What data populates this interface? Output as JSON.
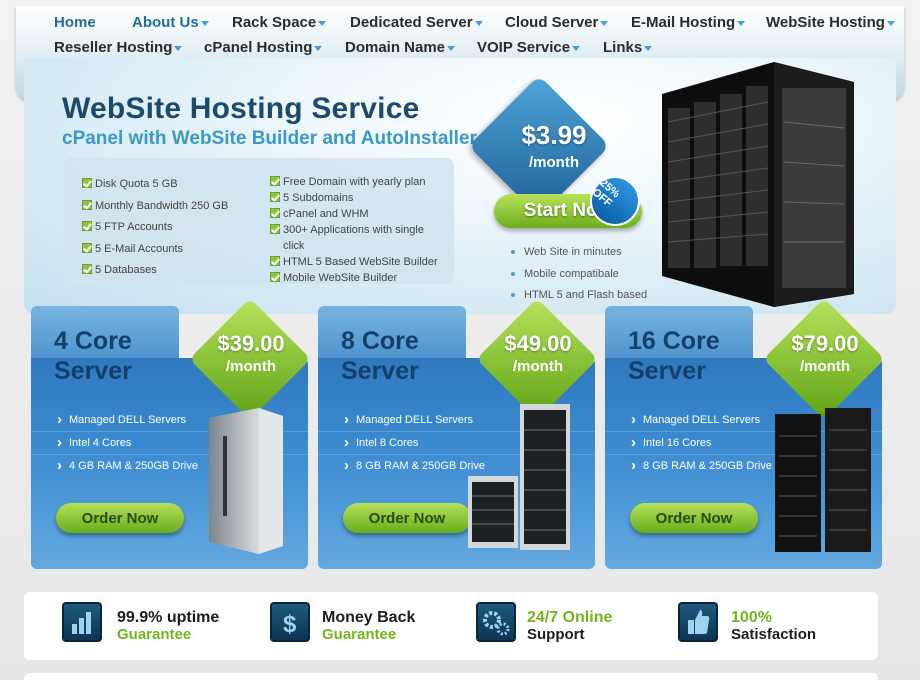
{
  "nav": {
    "row1": [
      {
        "label": "Home",
        "dropdown": false
      },
      {
        "label": "About Us",
        "dropdown": true
      },
      {
        "label": "Rack Space",
        "dropdown": true
      },
      {
        "label": "Dedicated Server",
        "dropdown": true
      },
      {
        "label": "Cloud Server",
        "dropdown": true
      },
      {
        "label": "E-Mail Hosting",
        "dropdown": true
      },
      {
        "label": "WebSite Hosting",
        "dropdown": true
      }
    ],
    "row2": [
      {
        "label": "Reseller Hosting",
        "dropdown": true
      },
      {
        "label": "cPanel Hosting",
        "dropdown": true
      },
      {
        "label": "Domain Name",
        "dropdown": true
      },
      {
        "label": "VOIP Service",
        "dropdown": true
      },
      {
        "label": "Links",
        "dropdown": true
      }
    ]
  },
  "hero": {
    "title": "WebSite Hosting Service",
    "subtitle": "cPanel with WebSite Builder and AutoInstaller",
    "features_left": [
      "Disk Quota 5 GB",
      "Monthly Bandwidth 250 GB",
      "5 FTP Accounts",
      "5 E-Mail Accounts",
      "5 Databases"
    ],
    "features_right": [
      "Free Domain with yearly plan",
      "5 Subdomains",
      "cPanel and WHM",
      "300+ Applications with single click",
      "HTML 5 Based WebSite Builder",
      "Mobile WebSite Builder"
    ],
    "price": "$3.99",
    "period": "/month",
    "cta": "Start Now",
    "badge": "25% OFF",
    "bullets": [
      "Web Site in minutes",
      "Mobile compatibale",
      "HTML 5 and Flash based"
    ]
  },
  "plans": [
    {
      "title_line1": "4 Core",
      "title_line2": "Server",
      "price": "$39.00",
      "period": "/month",
      "features": [
        "Managed DELL Servers",
        "Intel 4 Cores",
        "4 GB RAM & 250GB Drive"
      ],
      "cta": "Order Now"
    },
    {
      "title_line1": "8 Core",
      "title_line2": "Server",
      "price": "$49.00",
      "period": "/month",
      "features": [
        "Managed DELL Servers",
        "Intel 8 Cores",
        "8 GB RAM & 250GB Drive"
      ],
      "cta": "Order Now"
    },
    {
      "title_line1": "16 Core",
      "title_line2": "Server",
      "price": "$79.00",
      "period": "/month",
      "features": [
        "Managed DELL Servers",
        "Intel 16 Cores",
        "8 GB RAM & 250GB Drive"
      ],
      "cta": "Order Now"
    }
  ],
  "guarantees": [
    {
      "icon": "bar-chart-icon",
      "line1": "99.9% uptime",
      "line2": "Guarantee"
    },
    {
      "icon": "dollar-icon",
      "line1": "Money Back",
      "line2": "Guarantee"
    },
    {
      "icon": "gears-icon",
      "line1": "24/7 Online",
      "line2": "Support",
      "green_first": true
    },
    {
      "icon": "thumbs-up-icon",
      "line1": "100%",
      "line2": "Satisfaction",
      "green_first": true
    }
  ],
  "colors": {
    "accent_blue": "#3a8ad0",
    "accent_green": "#72b51c",
    "dark_text": "#1c4a6a"
  }
}
